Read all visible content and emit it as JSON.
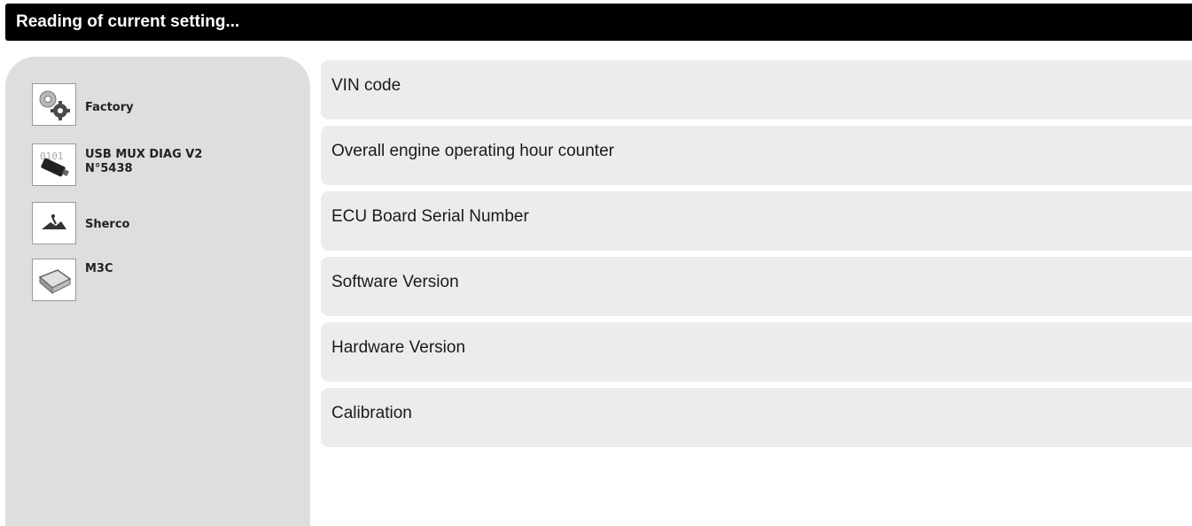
{
  "header": {
    "title": "Reading of current setting..."
  },
  "sidebar": {
    "items": [
      {
        "label": "Factory",
        "icon": "gears-icon"
      },
      {
        "label": "USB MUX DIAG V2\nN°5438",
        "icon": "usb-interface-icon"
      },
      {
        "label": "Sherco",
        "icon": "motorcycle-icon"
      },
      {
        "label": "M3C",
        "icon": "ecu-module-icon"
      }
    ]
  },
  "main": {
    "rows": [
      {
        "label": "VIN code"
      },
      {
        "label": "Overall engine operating hour counter"
      },
      {
        "label": "ECU Board Serial Number"
      },
      {
        "label": "Software Version"
      },
      {
        "label": "Hardware Version"
      },
      {
        "label": "Calibration"
      }
    ]
  },
  "colors": {
    "titlebar": "#000000",
    "sidebar": "#dedede",
    "row": "#ececec"
  }
}
